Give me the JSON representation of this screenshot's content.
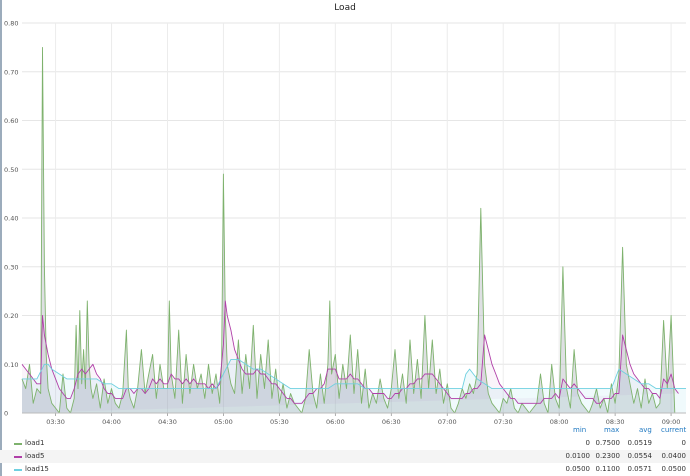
{
  "panel": {
    "title": "Load"
  },
  "legend": {
    "headers": {
      "min": "min",
      "max": "max",
      "avg": "avg",
      "current": "current"
    },
    "rows": [
      {
        "name": "load1",
        "color": "#7eb26d",
        "min": "0",
        "max": "0.7500",
        "avg": "0.0519",
        "current": "0"
      },
      {
        "name": "load5",
        "color": "#b03fa8",
        "min": "0.0100",
        "max": "0.2300",
        "avg": "0.0554",
        "current": "0.0400"
      },
      {
        "name": "load15",
        "color": "#6ed0e0",
        "min": "0.0500",
        "max": "0.1100",
        "avg": "0.0571",
        "current": "0.0500"
      }
    ]
  },
  "chart_data": {
    "type": "line",
    "title": "Load",
    "x_range": [
      "03:12",
      "09:08"
    ],
    "x_ticks": [
      "03:30",
      "04:00",
      "04:30",
      "05:00",
      "05:30",
      "06:00",
      "06:30",
      "07:00",
      "07:30",
      "08:00",
      "08:30",
      "09:00"
    ],
    "x_tick_minutes": [
      210,
      240,
      270,
      300,
      330,
      360,
      390,
      420,
      450,
      480,
      510,
      540
    ],
    "x_range_minutes": [
      192,
      548
    ],
    "ylim": [
      0,
      0.8
    ],
    "y_ticks": [
      "0",
      "0.10",
      "0.20",
      "0.30",
      "0.40",
      "0.50",
      "0.60",
      "0.70",
      "0.80"
    ],
    "y_tick_values": [
      0,
      0.1,
      0.2,
      0.3,
      0.4,
      0.5,
      0.6,
      0.7,
      0.8
    ],
    "grid": true,
    "legend_position": "bottom",
    "series": [
      {
        "name": "load1",
        "color": "#7eb26d",
        "t": [
          192,
          194,
          196,
          198,
          200,
          202,
          203,
          204,
          205,
          206,
          208,
          210,
          212,
          214,
          216,
          218,
          220,
          221,
          222,
          223,
          224,
          225,
          226,
          227,
          228,
          229,
          230,
          232,
          234,
          236,
          238,
          240,
          242,
          244,
          246,
          248,
          249,
          250,
          252,
          254,
          256,
          258,
          260,
          262,
          264,
          266,
          268,
          270,
          271,
          272,
          274,
          276,
          278,
          280,
          282,
          284,
          286,
          288,
          290,
          292,
          294,
          296,
          298,
          299,
          300,
          301,
          302,
          304,
          306,
          308,
          310,
          312,
          314,
          316,
          318,
          320,
          322,
          324,
          326,
          328,
          330,
          332,
          334,
          336,
          338,
          340,
          342,
          344,
          346,
          348,
          350,
          352,
          354,
          356,
          357,
          358,
          360,
          362,
          364,
          366,
          368,
          370,
          372,
          374,
          376,
          378,
          380,
          382,
          384,
          386,
          388,
          390,
          392,
          394,
          396,
          398,
          400,
          402,
          404,
          406,
          408,
          410,
          412,
          414,
          416,
          418,
          420,
          422,
          424,
          426,
          428,
          430,
          432,
          434,
          436,
          438,
          440,
          442,
          444,
          446,
          448,
          450,
          452,
          454,
          456,
          458,
          460,
          462,
          464,
          466,
          468,
          470,
          472,
          474,
          476,
          478,
          480,
          482,
          484,
          486,
          488,
          490,
          492,
          494,
          496,
          498,
          500,
          502,
          504,
          506,
          508,
          510,
          512,
          514,
          516,
          518,
          520,
          522,
          524,
          526,
          528,
          530,
          532,
          534,
          536,
          538,
          540,
          542,
          544,
          546,
          548
        ],
        "v": [
          0.07,
          0.05,
          0.1,
          0.02,
          0.05,
          0.04,
          0.75,
          0.3,
          0.12,
          0.05,
          0.02,
          0.01,
          0.0,
          0.08,
          0.01,
          0.0,
          0.03,
          0.18,
          0.05,
          0.21,
          0.06,
          0.13,
          0.05,
          0.23,
          0.1,
          0.05,
          0.03,
          0.06,
          0.01,
          0.07,
          0.02,
          0.05,
          0.02,
          0.01,
          0.04,
          0.17,
          0.05,
          0.03,
          0.01,
          0.05,
          0.13,
          0.04,
          0.08,
          0.12,
          0.03,
          0.1,
          0.05,
          0.05,
          0.23,
          0.08,
          0.03,
          0.17,
          0.02,
          0.12,
          0.04,
          0.1,
          0.05,
          0.08,
          0.03,
          0.1,
          0.04,
          0.08,
          0.02,
          0.1,
          0.49,
          0.2,
          0.1,
          0.06,
          0.04,
          0.15,
          0.04,
          0.12,
          0.05,
          0.18,
          0.03,
          0.12,
          0.05,
          0.15,
          0.03,
          0.09,
          0.02,
          0.06,
          0.01,
          0.04,
          0.02,
          0.01,
          0.0,
          0.03,
          0.13,
          0.04,
          0.01,
          0.08,
          0.02,
          0.1,
          0.23,
          0.08,
          0.12,
          0.03,
          0.1,
          0.05,
          0.16,
          0.04,
          0.13,
          0.02,
          0.09,
          0.01,
          0.04,
          0.02,
          0.07,
          0.03,
          0.01,
          0.05,
          0.13,
          0.03,
          0.08,
          0.02,
          0.15,
          0.04,
          0.11,
          0.03,
          0.2,
          0.05,
          0.15,
          0.04,
          0.09,
          0.02,
          0.06,
          0.01,
          0.0,
          0.02,
          0.05,
          0.03,
          0.06,
          0.04,
          0.08,
          0.42,
          0.1,
          0.04,
          0.02,
          0.01,
          0.0,
          0.03,
          0.02,
          0.05,
          0.01,
          0.0,
          0.02,
          0.01,
          0.0,
          0.01,
          0.02,
          0.08,
          0.02,
          0.0,
          0.1,
          0.03,
          0.01,
          0.3,
          0.05,
          0.01,
          0.13,
          0.04,
          0.02,
          0.01,
          0.0,
          0.02,
          0.05,
          0.01,
          0.03,
          0.0,
          0.06,
          0.02,
          0.08,
          0.34,
          0.1,
          0.06,
          0.02,
          0.05,
          0.01,
          0.07,
          0.02,
          0.04,
          0.01,
          0.02,
          0.19,
          0.05,
          0.2,
          0.0,
          0.0
        ]
      },
      {
        "name": "load5",
        "color": "#b03fa8",
        "t": [
          192,
          194,
          196,
          198,
          200,
          202,
          203,
          204,
          206,
          208,
          210,
          212,
          214,
          216,
          218,
          220,
          222,
          224,
          226,
          228,
          230,
          232,
          234,
          236,
          238,
          240,
          242,
          244,
          246,
          248,
          250,
          252,
          254,
          256,
          258,
          260,
          262,
          264,
          266,
          268,
          270,
          272,
          274,
          276,
          278,
          280,
          282,
          284,
          286,
          288,
          290,
          292,
          294,
          296,
          298,
          300,
          301,
          302,
          304,
          306,
          308,
          310,
          312,
          314,
          316,
          318,
          320,
          322,
          324,
          326,
          328,
          330,
          332,
          334,
          336,
          338,
          340,
          342,
          344,
          346,
          348,
          350,
          352,
          354,
          356,
          358,
          360,
          362,
          364,
          366,
          368,
          370,
          372,
          374,
          376,
          378,
          380,
          382,
          384,
          386,
          388,
          390,
          392,
          394,
          396,
          398,
          400,
          402,
          404,
          406,
          408,
          410,
          412,
          414,
          416,
          418,
          420,
          422,
          424,
          426,
          428,
          430,
          432,
          434,
          436,
          438,
          440,
          442,
          444,
          446,
          448,
          450,
          452,
          454,
          456,
          458,
          460,
          462,
          464,
          466,
          468,
          470,
          472,
          474,
          476,
          478,
          480,
          482,
          484,
          486,
          488,
          490,
          492,
          494,
          496,
          498,
          500,
          502,
          504,
          506,
          508,
          510,
          512,
          514,
          516,
          518,
          520,
          522,
          524,
          526,
          528,
          530,
          532,
          534,
          536,
          538,
          540,
          542,
          544,
          546,
          548
        ],
        "v": [
          0.1,
          0.09,
          0.08,
          0.07,
          0.06,
          0.06,
          0.2,
          0.16,
          0.12,
          0.09,
          0.07,
          0.05,
          0.04,
          0.03,
          0.03,
          0.05,
          0.08,
          0.09,
          0.08,
          0.09,
          0.1,
          0.08,
          0.07,
          0.05,
          0.04,
          0.04,
          0.03,
          0.03,
          0.03,
          0.05,
          0.05,
          0.04,
          0.05,
          0.05,
          0.04,
          0.05,
          0.07,
          0.06,
          0.07,
          0.06,
          0.06,
          0.08,
          0.07,
          0.07,
          0.06,
          0.07,
          0.06,
          0.07,
          0.06,
          0.06,
          0.06,
          0.05,
          0.06,
          0.05,
          0.06,
          0.14,
          0.23,
          0.2,
          0.17,
          0.13,
          0.11,
          0.09,
          0.08,
          0.08,
          0.08,
          0.09,
          0.08,
          0.08,
          0.07,
          0.06,
          0.06,
          0.05,
          0.04,
          0.03,
          0.03,
          0.02,
          0.02,
          0.02,
          0.03,
          0.04,
          0.04,
          0.05,
          0.05,
          0.06,
          0.09,
          0.09,
          0.09,
          0.07,
          0.07,
          0.07,
          0.08,
          0.07,
          0.07,
          0.06,
          0.05,
          0.05,
          0.04,
          0.04,
          0.04,
          0.04,
          0.03,
          0.03,
          0.04,
          0.04,
          0.05,
          0.05,
          0.06,
          0.06,
          0.07,
          0.07,
          0.08,
          0.08,
          0.08,
          0.07,
          0.06,
          0.05,
          0.04,
          0.03,
          0.03,
          0.03,
          0.03,
          0.04,
          0.04,
          0.05,
          0.05,
          0.06,
          0.16,
          0.13,
          0.1,
          0.08,
          0.06,
          0.05,
          0.04,
          0.03,
          0.03,
          0.02,
          0.02,
          0.02,
          0.02,
          0.02,
          0.02,
          0.02,
          0.03,
          0.03,
          0.03,
          0.04,
          0.03,
          0.07,
          0.06,
          0.05,
          0.06,
          0.05,
          0.04,
          0.03,
          0.03,
          0.03,
          0.02,
          0.02,
          0.03,
          0.03,
          0.03,
          0.04,
          0.04,
          0.16,
          0.13,
          0.1,
          0.08,
          0.07,
          0.06,
          0.05,
          0.05,
          0.04,
          0.04,
          0.03,
          0.07,
          0.06,
          0.08,
          0.05,
          0.04
        ]
      },
      {
        "name": "load15",
        "color": "#6ed0e0",
        "t": [
          192,
          196,
          198,
          200,
          204,
          206,
          208,
          212,
          216,
          220,
          224,
          228,
          232,
          236,
          240,
          244,
          248,
          252,
          256,
          260,
          264,
          268,
          272,
          276,
          280,
          284,
          288,
          292,
          296,
          300,
          304,
          308,
          312,
          316,
          320,
          324,
          328,
          332,
          336,
          340,
          344,
          348,
          352,
          356,
          360,
          364,
          368,
          372,
          376,
          380,
          384,
          388,
          392,
          396,
          400,
          404,
          408,
          412,
          416,
          420,
          424,
          428,
          430,
          432,
          436,
          440,
          444,
          448,
          452,
          456,
          460,
          464,
          468,
          472,
          476,
          480,
          484,
          488,
          492,
          496,
          500,
          504,
          508,
          512,
          516,
          520,
          524,
          528,
          532,
          536,
          540,
          544,
          548
        ],
        "v": [
          0.07,
          0.07,
          0.07,
          0.07,
          0.1,
          0.1,
          0.09,
          0.08,
          0.07,
          0.07,
          0.07,
          0.07,
          0.07,
          0.06,
          0.06,
          0.05,
          0.05,
          0.05,
          0.05,
          0.05,
          0.05,
          0.05,
          0.05,
          0.05,
          0.05,
          0.05,
          0.05,
          0.05,
          0.05,
          0.08,
          0.11,
          0.11,
          0.1,
          0.09,
          0.09,
          0.08,
          0.07,
          0.06,
          0.05,
          0.05,
          0.05,
          0.05,
          0.05,
          0.05,
          0.06,
          0.06,
          0.06,
          0.06,
          0.05,
          0.05,
          0.05,
          0.05,
          0.05,
          0.05,
          0.05,
          0.05,
          0.05,
          0.05,
          0.05,
          0.05,
          0.05,
          0.05,
          0.08,
          0.09,
          0.07,
          0.06,
          0.05,
          0.05,
          0.05,
          0.05,
          0.05,
          0.05,
          0.05,
          0.05,
          0.05,
          0.05,
          0.05,
          0.05,
          0.05,
          0.05,
          0.05,
          0.05,
          0.05,
          0.09,
          0.08,
          0.07,
          0.06,
          0.06,
          0.05,
          0.05,
          0.05,
          0.05,
          0.05
        ]
      }
    ]
  }
}
